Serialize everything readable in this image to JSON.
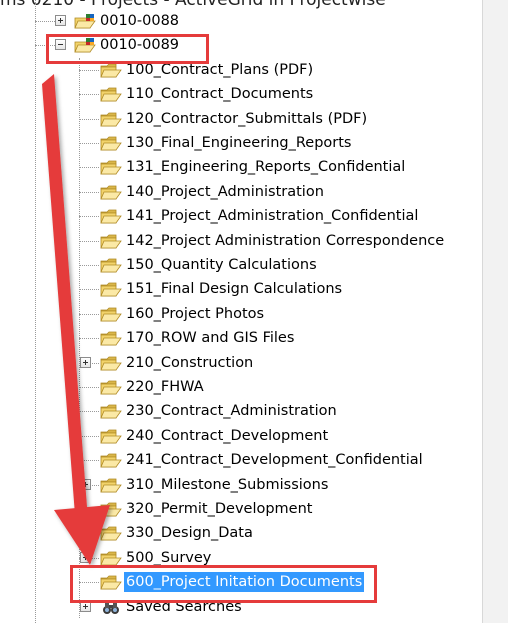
{
  "window": {
    "title": "ms 0210 - Projects - ActiveGrid in Projectwise"
  },
  "tree": {
    "projects": [
      {
        "label": "0010-0088",
        "expanded": false
      },
      {
        "label": "0010-0089",
        "expanded": true
      }
    ],
    "folders": [
      {
        "label": "100_Contract_Plans (PDF)",
        "has_children": false
      },
      {
        "label": "110_Contract_Documents",
        "has_children": false
      },
      {
        "label": "120_Contractor_Submittals (PDF)",
        "has_children": false
      },
      {
        "label": "130_Final_Engineering_Reports",
        "has_children": false
      },
      {
        "label": "131_Engineering_Reports_Confidential",
        "has_children": false
      },
      {
        "label": "140_Project_Administration",
        "has_children": false
      },
      {
        "label": "141_Project_Administration_Confidential",
        "has_children": false
      },
      {
        "label": "142_Project Administration Correspondence",
        "has_children": false
      },
      {
        "label": "150_Quantity Calculations",
        "has_children": false
      },
      {
        "label": "151_Final Design Calculations",
        "has_children": false
      },
      {
        "label": "160_Project Photos",
        "has_children": false
      },
      {
        "label": "170_ROW and GIS  Files",
        "has_children": false
      },
      {
        "label": "210_Construction",
        "has_children": true
      },
      {
        "label": "220_FHWA",
        "has_children": false
      },
      {
        "label": "230_Contract_Administration",
        "has_children": false
      },
      {
        "label": "240_Contract_Development",
        "has_children": false
      },
      {
        "label": "241_Contract_Development_Confidential",
        "has_children": false
      },
      {
        "label": "310_Milestone_Submissions",
        "has_children": true
      },
      {
        "label": "320_Permit_Development",
        "has_children": false
      },
      {
        "label": "330_Design_Data",
        "has_children": false
      },
      {
        "label": "500_Survey",
        "has_children": true
      },
      {
        "label": "600_Project Initation Documents",
        "has_children": false,
        "selected": true
      }
    ],
    "saved_searches": {
      "label": "Saved Searches"
    }
  },
  "colors": {
    "selection": "#3399ff",
    "annotation_red": "#e53b3b",
    "folder": "#f2d36b"
  },
  "icons": {
    "project": "project-folder-icon",
    "folder": "folder-icon",
    "saved_searches": "binoculars-icon",
    "expander": "plus-minus-expander-icon"
  }
}
